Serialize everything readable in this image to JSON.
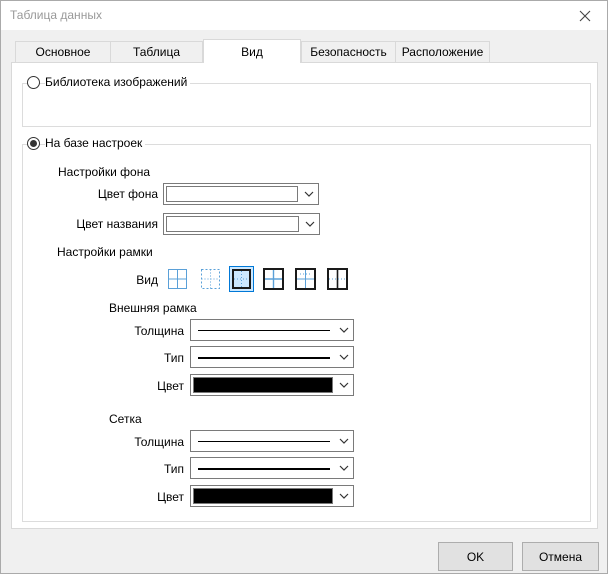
{
  "window": {
    "title": "Таблица данных"
  },
  "tabs": [
    {
      "label": "Основное"
    },
    {
      "label": "Таблица"
    },
    {
      "label": "Вид"
    },
    {
      "label": "Безопасность"
    },
    {
      "label": "Расположение"
    }
  ],
  "active_tab": "Вид",
  "image_library": {
    "label": "Библиотека изображений",
    "selected": false
  },
  "settings_based": {
    "label": "На базе настроек",
    "selected": true
  },
  "background_settings": {
    "heading": "Настройки фона",
    "bg_color_label": "Цвет фона",
    "bg_color_value": "#ffffff",
    "name_color_label": "Цвет названия",
    "name_color_value": "#ffffff"
  },
  "frame_settings": {
    "heading": "Настройки рамки",
    "view_label": "Вид",
    "presets": [
      "grid-all-light",
      "grid-inner-dotted",
      "outer-only-thick",
      "outer-and-grid-thick",
      "grid-dotted-outer",
      "grid-thick-outer-dotted"
    ],
    "selected_preset": 2
  },
  "outer_frame": {
    "heading": "Внешняя рамка",
    "thickness_label": "Толщина",
    "type_label": "Тип",
    "color_label": "Цвет",
    "color_value": "#000000"
  },
  "grid": {
    "heading": "Сетка",
    "thickness_label": "Толщина",
    "type_label": "Тип",
    "color_label": "Цвет",
    "color_value": "#000000"
  },
  "buttons": {
    "ok": "OK",
    "cancel": "Отмена"
  },
  "colors": {
    "accent": "#0078d7",
    "selected_bg": "#cce8ff"
  }
}
